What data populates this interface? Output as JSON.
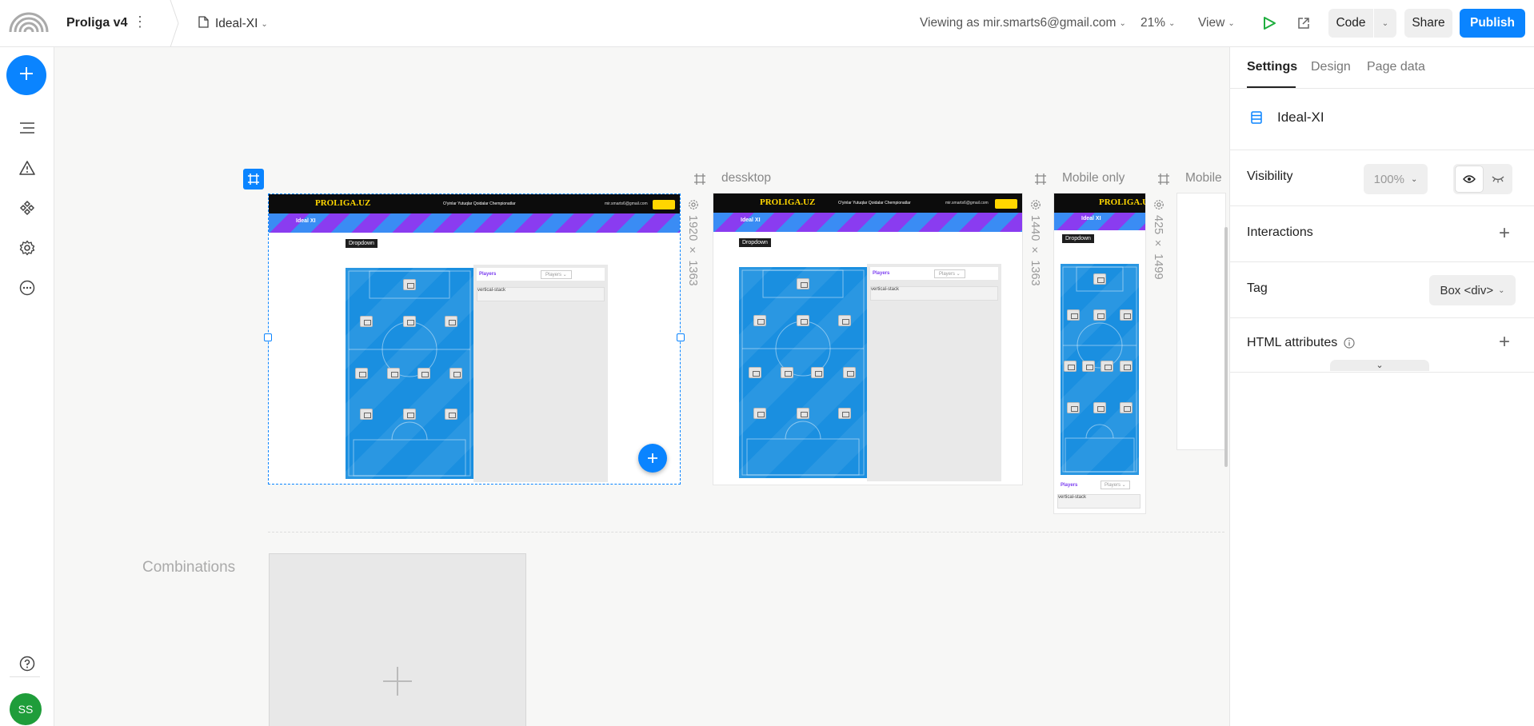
{
  "topbar": {
    "project_name": "Proliga v4",
    "page_name": "Ideal-XI",
    "viewing_as": "Viewing as mir.smarts6@gmail.com",
    "zoom": "21%",
    "view_label": "View",
    "code_label": "Code",
    "share_label": "Share",
    "publish_label": "Publish"
  },
  "sidebar": {
    "avatar_initials": "SS"
  },
  "panel": {
    "tabs": [
      "Settings",
      "Design",
      "Page data"
    ],
    "element_name": "Ideal-XI",
    "visibility_label": "Visibility",
    "visibility_value": "100%",
    "interactions_label": "Interactions",
    "tag_label": "Tag",
    "tag_value": "Box <div>",
    "html_attributes_label": "HTML attributes"
  },
  "canvas": {
    "frames": [
      {
        "label": "",
        "dims": "1920 × 1363"
      },
      {
        "label": "dessktop",
        "dims": "1440 × 1363"
      },
      {
        "label": "Mobile only",
        "dims": "425 × 1499"
      },
      {
        "label": "Mobile"
      }
    ],
    "combinations_label": "Combinations",
    "site": {
      "logo": "PROLIGA.UZ",
      "menu": "O'yinlar  Yutuqlar  Qoidalar  Chempionatlar",
      "email": "mir.smarts6@gmail.com",
      "banner": "Ideal XI",
      "dropdown": "Dropdown",
      "players_label": "Players",
      "players_select": "Players ⌄",
      "textarea": "vertical-stack"
    }
  },
  "colors": {
    "accent": "#0a84ff",
    "avatar": "#1f9d3a",
    "pitch": "#1a8fe0",
    "banner_blue": "#3a8cf4",
    "banner_purple": "#8a3cf0",
    "logo_yellow": "#ffd600"
  }
}
